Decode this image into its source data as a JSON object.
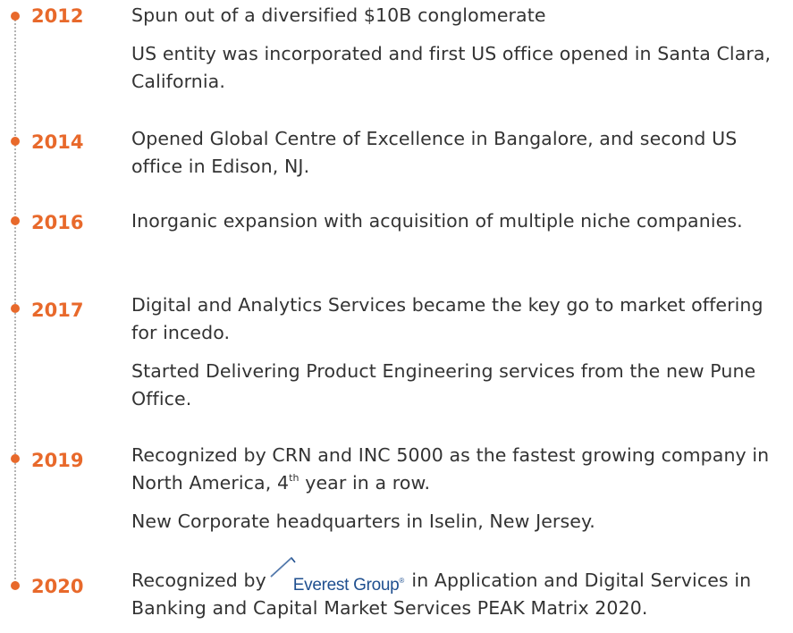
{
  "accent_color": "#e8692b",
  "text_color": "#333333",
  "logo_color": "#1f4f8f",
  "timeline": [
    {
      "year": "2012",
      "paragraphs": [
        "Spun out of a diversified $10B conglomerate",
        "US entity was incorporated and first US office opened in Santa Clara, California."
      ]
    },
    {
      "year": "2014",
      "paragraphs": [
        "Opened Global Centre of Excellence in Bangalore, and second US office in Edison, NJ."
      ]
    },
    {
      "year": "2016",
      "paragraphs": [
        "Inorganic expansion with acquisition of multiple niche companies."
      ]
    },
    {
      "year": "2017",
      "paragraphs": [
        "Digital and Analytics Services became the key go to market offering for incedo.",
        "Started Delivering Product Engineering services from the new Pune Office."
      ]
    },
    {
      "year": "2019",
      "p1_before": "Recognized by CRN and INC 5000 as the fastest growing company in North America, 4",
      "p1_sup": "th",
      "p1_after": " year in a row.",
      "p2": "New Corporate headquarters in Iselin, New Jersey."
    },
    {
      "year": "2020",
      "p1_before": "Recognized by",
      "logo_text": "Everest Group",
      "logo_mark": "®",
      "p1_after": " in Application and Digital Services in Banking and Capital Market Services PEAK Matrix 2020."
    }
  ]
}
